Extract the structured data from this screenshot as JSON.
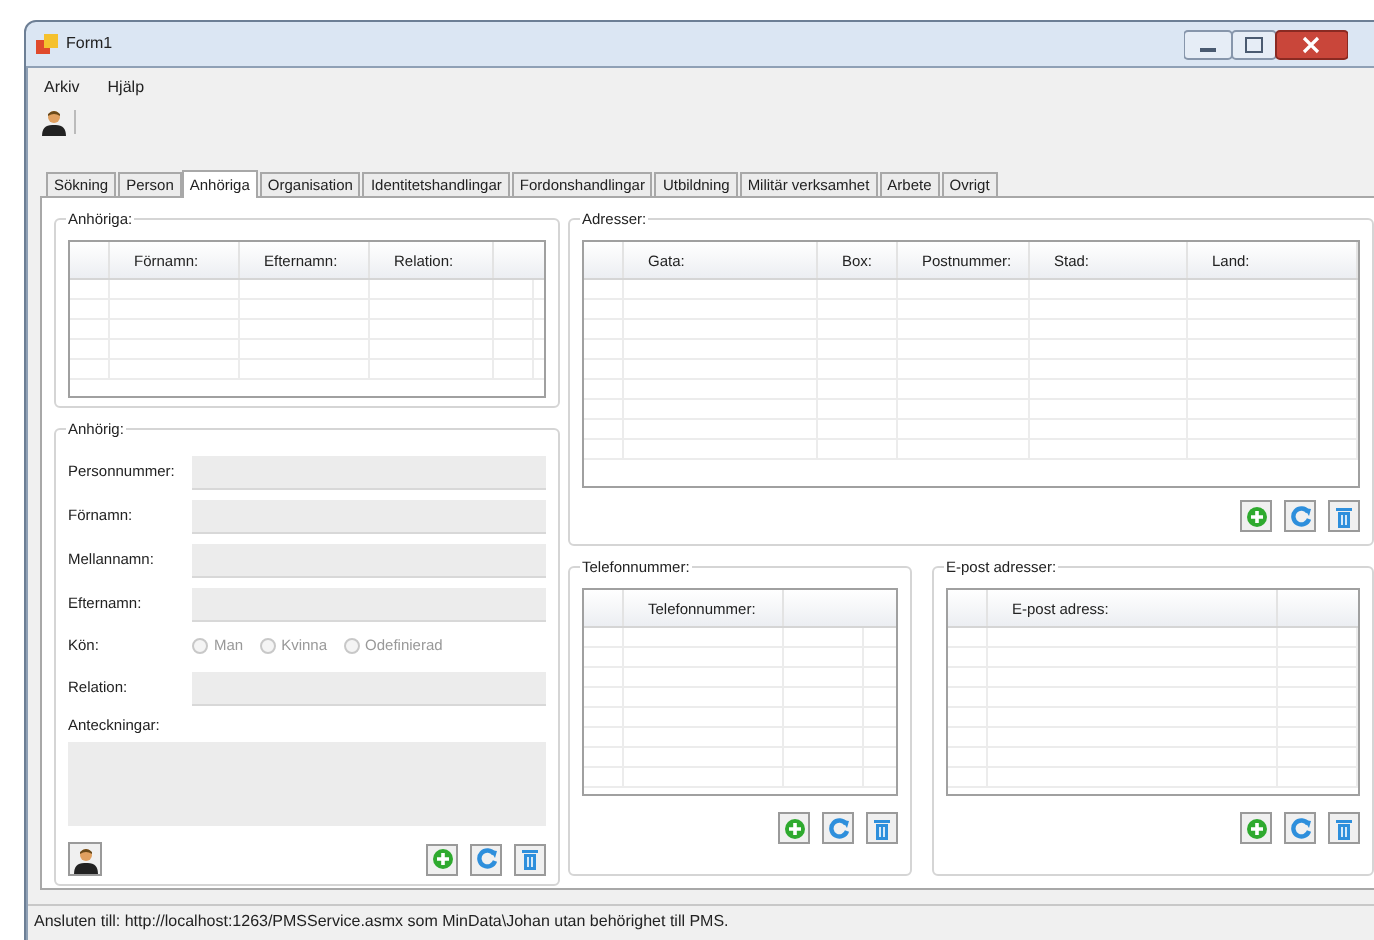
{
  "window": {
    "title": "Form1"
  },
  "menu": [
    {
      "label": "Arkiv"
    },
    {
      "label": "Hjälp"
    }
  ],
  "tabs": [
    {
      "label": "Sökning",
      "selected": false
    },
    {
      "label": "Person",
      "selected": false
    },
    {
      "label": "Anhöriga",
      "selected": true
    },
    {
      "label": "Organisation",
      "selected": false
    },
    {
      "label": "Identitetshandlingar",
      "selected": false
    },
    {
      "label": "Fordonshandlingar",
      "selected": false
    },
    {
      "label": "Utbildning",
      "selected": false
    },
    {
      "label": "Militär verksamhet",
      "selected": false
    },
    {
      "label": "Arbete",
      "selected": false
    },
    {
      "label": "Ovrigt",
      "selected": false
    }
  ],
  "relatives": {
    "title": "Anhöriga:",
    "columns": [
      "Förnamn:",
      "Efternamn:",
      "Relation:"
    ]
  },
  "relative": {
    "title": "Anhörig:",
    "fields": [
      {
        "label": "Personnummer:"
      },
      {
        "label": "Förnamn:"
      },
      {
        "label": "Mellannamn:"
      },
      {
        "label": "Efternamn:"
      }
    ],
    "gender": {
      "label": "Kön:",
      "options": [
        {
          "label": "Man",
          "selected": false,
          "disabled": true
        },
        {
          "label": "Kvinna",
          "selected": false,
          "disabled": true
        },
        {
          "label": "Odefinierad",
          "selected": false,
          "disabled": true
        }
      ]
    },
    "relation": {
      "label": "Relation:"
    },
    "notes": {
      "label": "Anteckningar:"
    }
  },
  "addresses": {
    "title": "Adresser:",
    "columns": [
      "Gata:",
      "Box:",
      "Postnummer:",
      "Stad:",
      "Land:"
    ]
  },
  "phones": {
    "title": "Telefonnummer:",
    "columns": [
      "Telefonnummer:"
    ]
  },
  "emails": {
    "title": "E-post adresser:",
    "columns": [
      "E-post adress:"
    ]
  },
  "status_bar": "Ansluten till: http://localhost:1263/PMSService.asmx som MinData\\Johan utan behörighet till PMS."
}
